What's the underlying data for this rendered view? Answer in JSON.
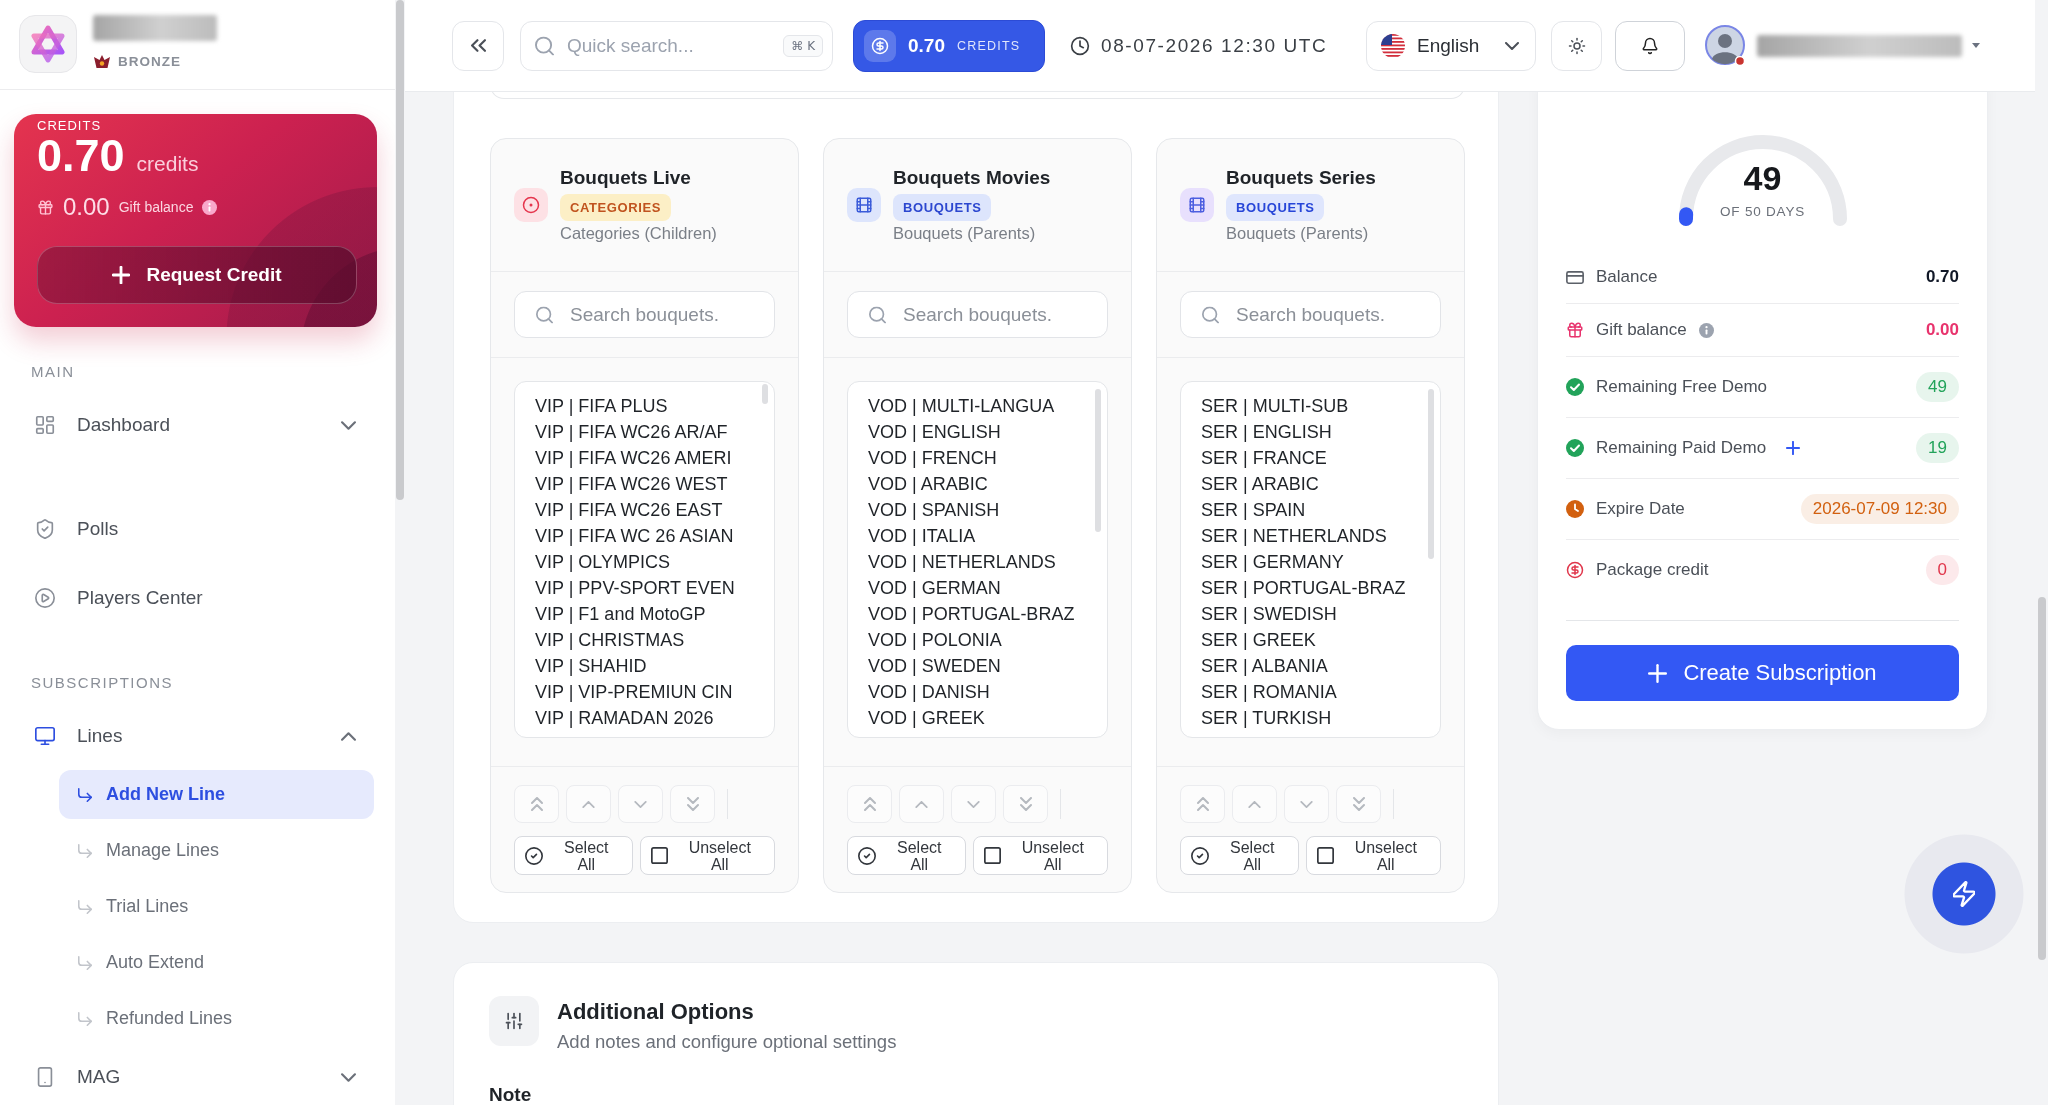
{
  "sidebar": {
    "tier": "BRONZE",
    "credit_card": {
      "label": "CREDITS",
      "amount": "0.70",
      "unit": "credits",
      "gift_amount": "0.00",
      "gift_label": "Gift balance",
      "button": "Request Credit"
    },
    "sections": [
      {
        "title": "MAIN",
        "items": [
          {
            "label": "Dashboard",
            "kind": "group",
            "expanded": false
          },
          {
            "label": "Polls",
            "kind": "link"
          },
          {
            "label": "Players Center",
            "kind": "link"
          }
        ]
      },
      {
        "title": "SUBSCRIPTIONS",
        "items": [
          {
            "label": "Lines",
            "kind": "group",
            "expanded": true,
            "children": [
              {
                "label": "Add New Line",
                "selected": true
              },
              {
                "label": "Manage Lines",
                "selected": false
              },
              {
                "label": "Trial Lines",
                "selected": false
              },
              {
                "label": "Auto Extend",
                "selected": false
              },
              {
                "label": "Refunded Lines",
                "selected": false
              }
            ]
          },
          {
            "label": "MAG",
            "kind": "group",
            "expanded": false
          }
        ]
      }
    ]
  },
  "topbar": {
    "search": {
      "placeholder": "Quick search...",
      "shortcut": "⌘ K"
    },
    "credits": {
      "amount": "0.70",
      "label": "CREDITS"
    },
    "datetime": "08-07-2026 12:30 UTC",
    "language": "English"
  },
  "bouquets": {
    "columns": [
      {
        "title": "Bouquets Live",
        "kind": "live",
        "badge": "CATEGORIES",
        "subtitle": "Categories (Children)",
        "search": {
          "placeholder": "Search bouquets."
        },
        "items": [
          "VIP | FIFA PLUS",
          "VIP | FIFA WC26 AR/AF",
          "VIP | FIFA WC26 AMERI",
          "VIP | FIFA WC26 WEST",
          "VIP | FIFA WC26 EAST",
          "VIP | FIFA WC 26 ASIAN",
          "VIP | OLYMPICS",
          "VIP | PPV-SPORT EVEN",
          "VIP | F1 and MotoGP",
          "VIP | CHRISTMAS",
          "VIP | SHAHID",
          "VIP | VIP-PREMIUN CIN",
          "VIP | RAMADAN 2026"
        ],
        "select_all": "Select All",
        "unselect_all": "Unselect All"
      },
      {
        "title": "Bouquets Movies",
        "kind": "movies",
        "badge": "BOUQUETS",
        "subtitle": "Bouquets (Parents)",
        "search": {
          "placeholder": "Search bouquets."
        },
        "items": [
          "VOD | MULTI-LANGUA",
          "VOD | ENGLISH",
          "VOD | FRENCH",
          "VOD | ARABIC",
          "VOD | SPANISH",
          "VOD | ITALIA",
          "VOD | NETHERLANDS",
          "VOD | GERMAN",
          "VOD | PORTUGAL-BRAZ",
          "VOD | POLONIA",
          "VOD | SWEDEN",
          "VOD | DANISH",
          "VOD | GREEK"
        ],
        "select_all": "Select All",
        "unselect_all": "Unselect All"
      },
      {
        "title": "Bouquets Series",
        "kind": "series",
        "badge": "BOUQUETS",
        "subtitle": "Bouquets (Parents)",
        "search": {
          "placeholder": "Search bouquets."
        },
        "items": [
          "SER | MULTI-SUB",
          "SER | ENGLISH",
          "SER | FRANCE",
          "SER | ARABIC",
          "SER | SPAIN",
          "SER | NETHERLANDS",
          "SER | GERMANY",
          "SER | PORTUGAL-BRAZ",
          "SER | SWEDISH",
          "SER | GREEK",
          "SER | ALBANIA",
          "SER | ROMANIA",
          "SER | TURKISH"
        ],
        "select_all": "Select All",
        "unselect_all": "Unselect All"
      }
    ]
  },
  "additional_options": {
    "title": "Additional Options",
    "subtitle": "Add notes and configure optional settings",
    "note_label": "Note"
  },
  "summary": {
    "gauge": {
      "value": "49",
      "caption": "OF 50 DAYS",
      "level": 0.02
    },
    "rows": [
      {
        "label": "Balance",
        "value": "0.70",
        "kind": "card",
        "color": "#111827",
        "info": false,
        "add": false
      },
      {
        "label": "Gift balance",
        "value": "0.00",
        "kind": "gift",
        "color": "#e8336d",
        "info": true,
        "add": false
      },
      {
        "label": "Remaining Free Demo",
        "value": "49",
        "kind": "check",
        "color": "#22a35a",
        "info": false,
        "add": false
      },
      {
        "label": "Remaining Paid Demo",
        "value": "19",
        "kind": "check",
        "color": "#22a35a",
        "info": false,
        "add": true
      },
      {
        "label": "Expire Date",
        "value": "2026-07-09 12:30",
        "kind": "clock",
        "color": "#d2600f",
        "info": false,
        "add": false
      },
      {
        "label": "Package credit",
        "value": "0",
        "kind": "dollar",
        "color": "#e0364b",
        "info": false,
        "add": false
      }
    ],
    "button": "Create Subscription"
  }
}
